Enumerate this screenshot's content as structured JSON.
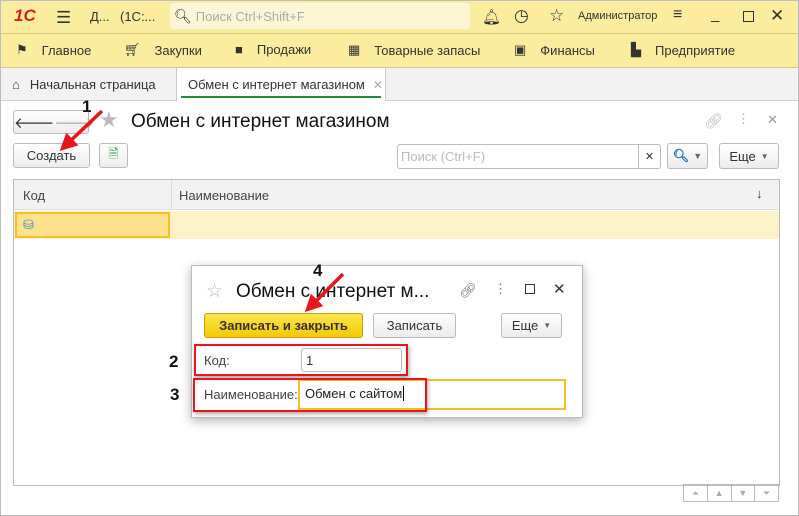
{
  "topbar": {
    "logo": "1С",
    "app_title": "Д...",
    "app_subtitle": "(1С:...",
    "search_placeholder": "Поиск Ctrl+Shift+F",
    "user": "Администратор"
  },
  "menu": {
    "items": [
      {
        "label": "Главное",
        "icon": "flag-icon"
      },
      {
        "label": "Закупки",
        "icon": "cart-icon"
      },
      {
        "label": "Продажи",
        "icon": "bag-icon"
      },
      {
        "label": "Товарные запасы",
        "icon": "grid-icon"
      },
      {
        "label": "Финансы",
        "icon": "wallet-icon"
      },
      {
        "label": "Предприятие",
        "icon": "factory-icon"
      }
    ]
  },
  "tabs": [
    {
      "label": "Начальная страница"
    },
    {
      "label": "Обмен с интернет магазином",
      "active": true
    }
  ],
  "list": {
    "title": "Обмен с интернет магазином",
    "create_label": "Создать",
    "search_placeholder": "Поиск (Ctrl+F)",
    "more_label": "Еще",
    "columns": [
      "Код",
      "Наименование"
    ],
    "sort_indicator": "↓",
    "rows": [
      {
        "code": "",
        "name": ""
      }
    ]
  },
  "dialog": {
    "title": "Обмен с интернет м...",
    "save_close_label": "Записать и закрыть",
    "save_label": "Записать",
    "more_label": "Еще",
    "code_label": "Код:",
    "code_value": "1",
    "name_label": "Наименование:",
    "name_value": "Обмен с сайтом"
  },
  "annotations": [
    "1",
    "2",
    "3",
    "4"
  ],
  "colors": {
    "topbar": "#fbec9e",
    "accent_yellow": "#f5cf1f",
    "annotation_red": "#e8161b",
    "active_tab_underline": "#1e8f3a"
  }
}
